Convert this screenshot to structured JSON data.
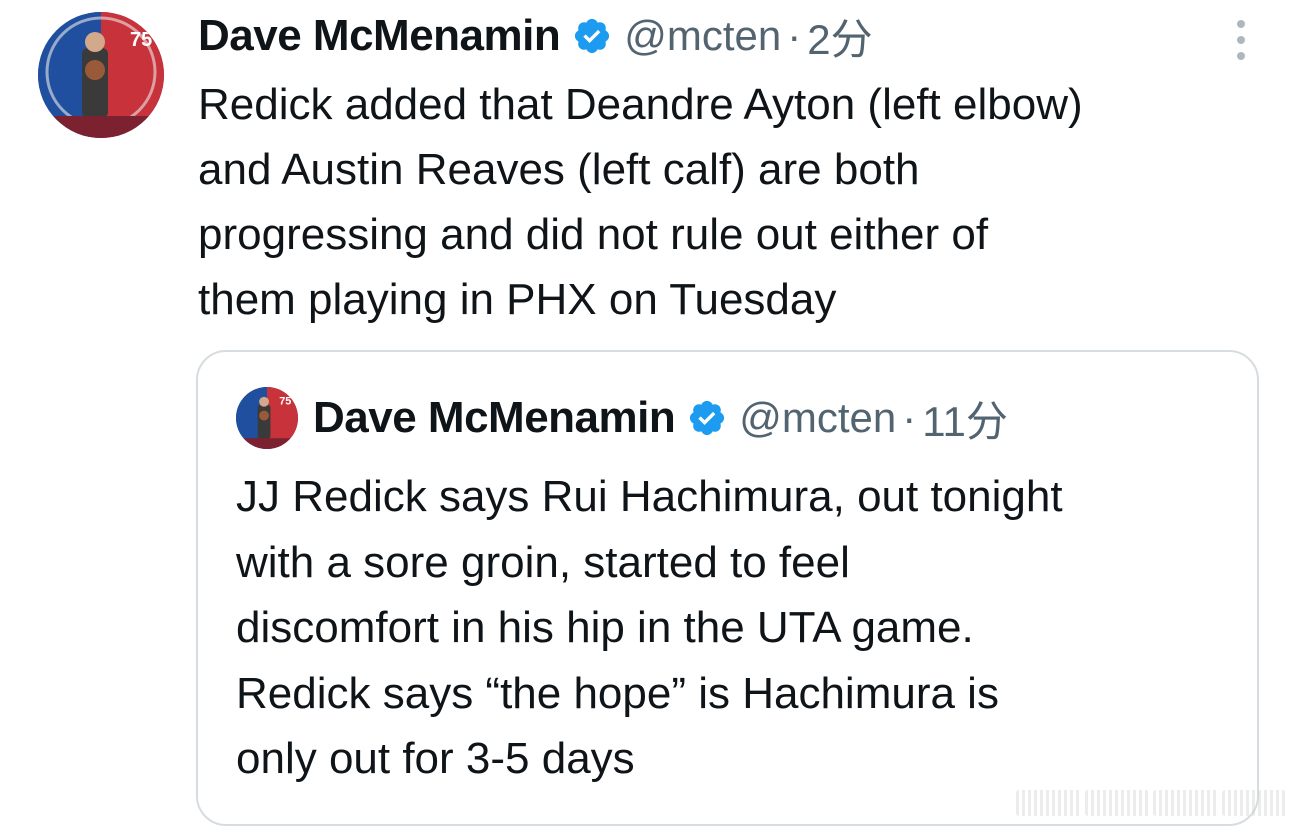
{
  "tweet": {
    "author_name": "Dave McMenamin",
    "handle": "@mcten",
    "separator": "·",
    "time": "2分",
    "text": "Redick added that Deandre Ayton (left elbow)\nand Austin Reaves (left calf) are both\nprogressing and did not rule out either of\nthem playing in PHX on Tuesday"
  },
  "quoted_tweet": {
    "author_name": "Dave McMenamin",
    "handle": "@mcten",
    "separator": "·",
    "time": "11分",
    "text": "JJ Redick says Rui Hachimura, out tonight\nwith a sore groin, started to feel\ndiscomfort in his hip in the UTA game.\nRedick says “the hope” is Hachimura is\nonly out for 3-5 days"
  },
  "icons": {
    "verified": "verified-badge-icon",
    "more": "more-options-icon"
  },
  "colors": {
    "verified_blue": "#1d9bf0",
    "secondary_text": "#536471",
    "primary_text": "#0f1419",
    "border": "#d6dce0"
  }
}
